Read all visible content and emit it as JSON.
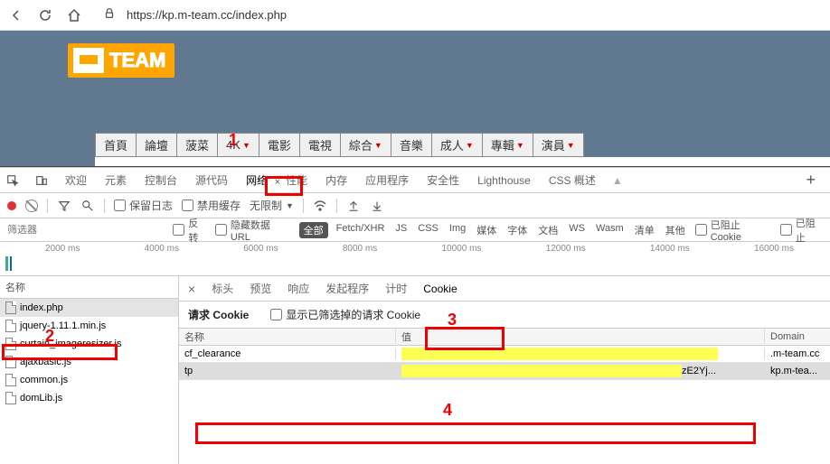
{
  "browser": {
    "url": "https://kp.m-team.cc/index.php"
  },
  "logo": {
    "text": "TEAM"
  },
  "siteNav": [
    {
      "label": "首頁",
      "dd": false
    },
    {
      "label": "論壇",
      "dd": false
    },
    {
      "label": "菠菜",
      "dd": false
    },
    {
      "label": "4K",
      "dd": true
    },
    {
      "label": "電影",
      "dd": false
    },
    {
      "label": "電視",
      "dd": false
    },
    {
      "label": "綜合",
      "dd": true
    },
    {
      "label": "音樂",
      "dd": false
    },
    {
      "label": "成人",
      "dd": true
    },
    {
      "label": "專輯",
      "dd": true
    },
    {
      "label": "演員",
      "dd": true
    }
  ],
  "devtools": {
    "tabs": [
      "欢迎",
      "元素",
      "控制台",
      "源代码",
      "网络",
      "性能",
      "内存",
      "应用程序",
      "安全性",
      "Lighthouse",
      "CSS 概述"
    ],
    "activeTab": 4,
    "controls": {
      "preserveLog": "保留日志",
      "disableCache": "禁用缓存",
      "throttle": "无限制"
    },
    "filters": {
      "placeholder": "筛选器",
      "invert": "反转",
      "hideUrl": "隐藏数据 URL",
      "types": [
        "全部",
        "Fetch/XHR",
        "JS",
        "CSS",
        "Img",
        "媒体",
        "字体",
        "文档",
        "WS",
        "Wasm",
        "清单",
        "其他"
      ],
      "blockedCookie": "已阻止 Cookie",
      "blocked": "已阻止"
    },
    "timeline": [
      "2000 ms",
      "4000 ms",
      "6000 ms",
      "8000 ms",
      "10000 ms",
      "12000 ms",
      "14000 ms",
      "16000 ms"
    ],
    "filePane": {
      "header": "名称",
      "files": [
        "index.php",
        "jquery-1.11.1.min.js",
        "curtain_imageresizer.js",
        "ajaxbasic.js",
        "common.js",
        "domLib.js"
      ],
      "selected": 0
    },
    "detail": {
      "tabs": [
        "标头",
        "预览",
        "响应",
        "发起程序",
        "计时",
        "Cookie"
      ],
      "active": 5,
      "reqCookie": "请求 Cookie",
      "showFiltered": "显示已筛选掉的请求 Cookie",
      "cols": {
        "name": "名称",
        "value": "值",
        "domain": "Domain"
      },
      "rows": [
        {
          "name": "cf_clearance",
          "value": "",
          "domain": ".m-team.cc",
          "hlw": 350,
          "trailing": ""
        },
        {
          "name": "tp",
          "value": "",
          "domain": "kp.m-tea...",
          "hlw": 310,
          "trailing": "zE2Yj..."
        }
      ]
    }
  },
  "annotations": {
    "l1": "1",
    "l2": "2",
    "l3": "3",
    "l4": "4"
  }
}
